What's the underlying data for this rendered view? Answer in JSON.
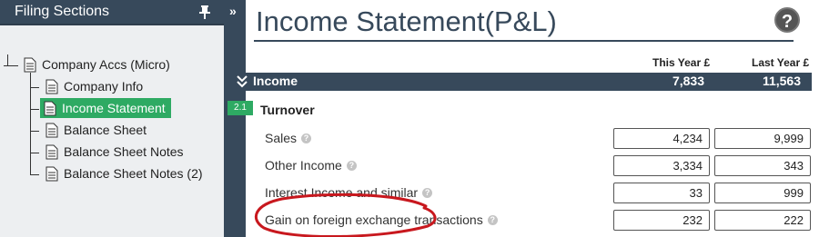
{
  "sidebar": {
    "title": "Filing Sections",
    "collapse_glyph": "»",
    "tree": {
      "root": "Company Accs (Micro)",
      "children": [
        {
          "label": "Company Info",
          "selected": false
        },
        {
          "label": "Income Statement",
          "selected": true
        },
        {
          "label": "Balance Sheet",
          "selected": false
        },
        {
          "label": "Balance Sheet Notes",
          "selected": false
        },
        {
          "label": "Balance Sheet Notes (2)",
          "selected": false
        }
      ]
    }
  },
  "main": {
    "title": "Income Statement(P&L)",
    "help_glyph": "?",
    "columns": {
      "this_year": "This Year £",
      "last_year": "Last Year £"
    },
    "income_section": {
      "chevron": "❯❯",
      "label": "Income",
      "this_year_total": "7,833",
      "last_year_total": "11,563"
    },
    "subsection": {
      "badge": "2.1",
      "label": "Turnover"
    },
    "rows": [
      {
        "label": "Sales",
        "this_year": "4,234",
        "last_year": "9,999"
      },
      {
        "label": "Other Income",
        "this_year": "3,334",
        "last_year": "343"
      },
      {
        "label": "Interest Income and similar",
        "this_year": "33",
        "last_year": "999"
      },
      {
        "label": "Gain on foreign exchange transactions",
        "this_year": "232",
        "last_year": "222"
      }
    ],
    "help_mark": "?"
  },
  "colors": {
    "sidebar_bg": "#37495b",
    "tree_bg": "#edeff1",
    "selected_green": "#2eaa63",
    "annotation_red": "#c8181e"
  },
  "icons": [
    "pin-icon",
    "document-icon",
    "help-icon",
    "chevron-double-down-icon",
    "question-icon"
  ]
}
